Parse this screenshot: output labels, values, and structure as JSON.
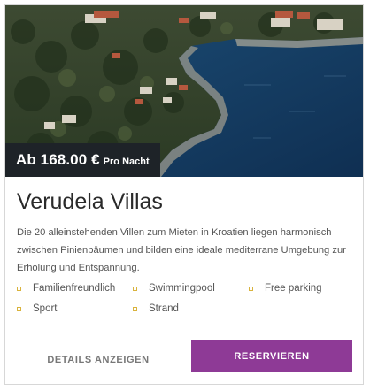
{
  "listing": {
    "price": "Ab 168.00 €",
    "price_unit": "Pro Nacht",
    "title": "Verudela Villas",
    "description": "Die 20 alleinstehenden Villen zum Mieten in Kroatien liegen harmonisch zwischen Pinienbäumen und bilden eine ideale mediterrane Umgebung zur Erholung und Entspannung.",
    "features": [
      {
        "label": "Familienfreundlich",
        "icon": "square-bullet-icon"
      },
      {
        "label": "Swimmingpool",
        "icon": "square-bullet-icon"
      },
      {
        "label": "Free parking",
        "icon": "square-bullet-icon"
      },
      {
        "label": "Sport",
        "icon": "square-bullet-icon"
      },
      {
        "label": "Strand",
        "icon": "square-bullet-icon"
      }
    ]
  },
  "actions": {
    "details_label": "DETAILS ANZEIGEN",
    "reserve_label": "RESERVIEREN"
  },
  "colors": {
    "accent": "#8e3a96",
    "bullet": "#d9b33d",
    "price_tag_bg": "#1e2328"
  }
}
